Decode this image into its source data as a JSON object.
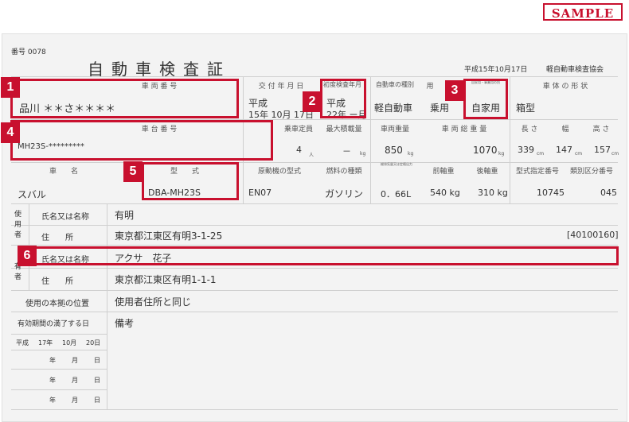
{
  "sample_label": "SAMPLE",
  "cert": {
    "number": "番号 0078",
    "title": "自動車検査証",
    "issue_date": "平成15年10月17日",
    "issuer": "軽自動車検査協会"
  },
  "headers": {
    "reg_number": "車 両 番 号",
    "issue_date": "交 付 年 月 日",
    "first_reg": "初度検査年月",
    "vehicle_type": "自動車の種別",
    "use": "用",
    "purpose_small": "自家用・事業用の別",
    "body_shape": "車 体 の 形 状",
    "chassis": "車 台 番 号",
    "capacity": "乗車定員",
    "max_load": "最大積載量",
    "weight": "車両重量",
    "gross_weight": "車 両 総 重 量",
    "length": "長 さ",
    "width": "幅",
    "height": "高 さ",
    "name": "車　　名",
    "model": "型　　式",
    "engine": "原動機の型式",
    "fuel": "燃料の種類",
    "displacement_small": "総排気量又は定格出力",
    "front_axle": "前軸重",
    "rear_axle": "後軸重",
    "model_no": "型式指定番号",
    "class_no": "類別区分番号"
  },
  "vehicle": {
    "reg_number": "品川 ＊＊さ＊＊＊＊",
    "issue_era": "平成",
    "issue_date": "15年 10月 17日",
    "first_reg_era": "平成",
    "first_reg": "22年 ー月",
    "type": "軽自動車",
    "use": "乗用",
    "purpose": "自家用",
    "body": "箱型",
    "chassis": "MH23S-*********",
    "capacity": "4",
    "capacity_unit": "人",
    "max_load": "－",
    "max_load_unit": "kg",
    "weight": "850",
    "weight_unit": "kg",
    "gross_weight": "1070",
    "gross_unit": "kg",
    "length": "339",
    "length_unit": "cm",
    "width": "147",
    "width_unit": "cm",
    "height": "157",
    "height_unit": "cm",
    "name": "スバル",
    "model": "DBA-MH23S",
    "engine": "EN07",
    "fuel": "ガソリン",
    "displacement": "0．66L",
    "front_axle": "540 kg",
    "rear_axle": "310 kg",
    "model_no": "10745",
    "class_no": "045"
  },
  "user": {
    "section": "使用者",
    "name_label": "氏名又は名称",
    "name": "有明",
    "address_label": "住　　所",
    "address": "東京都江東区有明3-1-25",
    "code": "[40100160]"
  },
  "owner": {
    "section_tail": "有者",
    "name_label": "氏名又は名称",
    "name": "アクサ　花子",
    "address_label": "住　　所",
    "address": "東京都江東区有明1-1-1"
  },
  "base": {
    "label": "使用の本拠の位置",
    "value": "使用者住所と同じ"
  },
  "expiry": {
    "label": "有効期間の満了する日",
    "remarks_label": "備考",
    "rows": [
      {
        "era": "平成",
        "year": "17年",
        "month": "10月",
        "day": "20日"
      },
      {
        "era": "",
        "year": "年",
        "month": "月",
        "day": "日"
      },
      {
        "era": "",
        "year": "年",
        "month": "月",
        "day": "日"
      },
      {
        "era": "",
        "year": "年",
        "month": "月",
        "day": "日"
      }
    ]
  },
  "badges": [
    "1",
    "2",
    "3",
    "4",
    "5",
    "6"
  ],
  "colors": {
    "accent": "#c8102e",
    "paper": "#f3f3f3"
  }
}
